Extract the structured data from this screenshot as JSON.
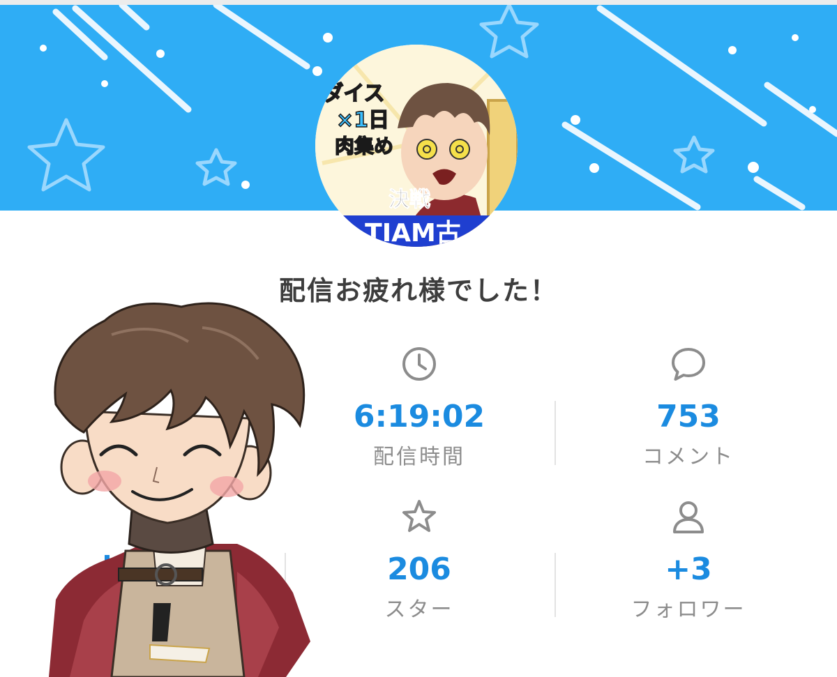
{
  "thumbnail": {
    "badge_top": "ダイス",
    "badge_mid": "×1日",
    "badge_low": "肉集め",
    "banner_word": "決戦",
    "bottom_text": "TIAM古"
  },
  "title": "配信お疲れ様でした！",
  "stats": {
    "duration": {
      "value": "6:19:02",
      "label": "配信時間",
      "icon": "clock-icon"
    },
    "comments": {
      "value": "753",
      "label": "コメント",
      "icon": "comment-icon"
    },
    "stars": {
      "value": "206",
      "label": "スター",
      "icon": "star-icon"
    },
    "followers": {
      "value": "+3",
      "label": "フォロワー",
      "icon": "person-icon"
    }
  },
  "colors": {
    "banner": "#2fadf5",
    "value": "#1b8be0",
    "label": "#8c8c8c",
    "title": "#3d3d3d"
  }
}
